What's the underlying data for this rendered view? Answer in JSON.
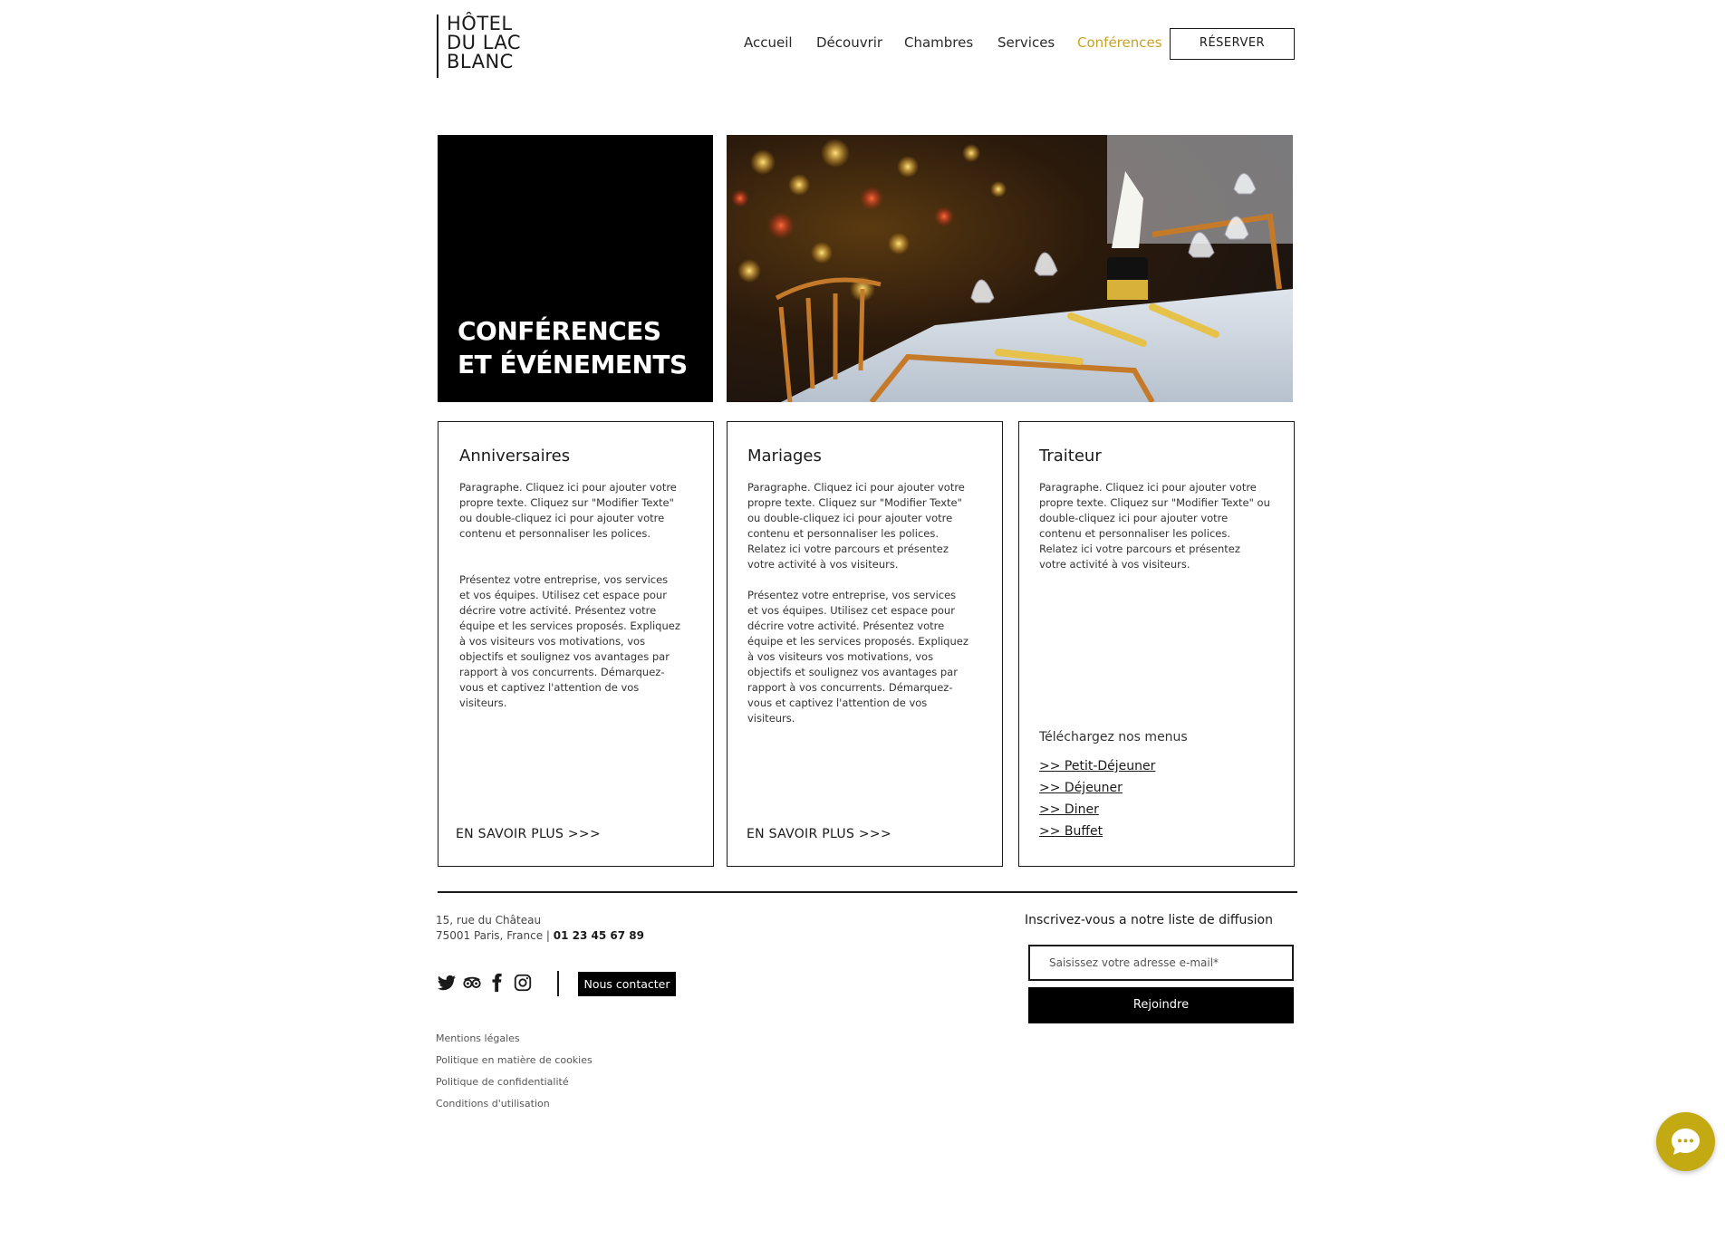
{
  "header": {
    "logo_lines": [
      "HÔTEL",
      "DU LAC",
      "BLANC"
    ],
    "nav": [
      "Accueil",
      "Découvrir",
      "Chambres",
      "Services",
      "Conférences"
    ],
    "active_nav": "Conférences",
    "reserve_label": "RÉSERVER"
  },
  "hero": {
    "title_line1": "CONFÉRENCES",
    "title_line2": "ET ÉVÉNEMENTS"
  },
  "cards": [
    {
      "title": "Anniversaires",
      "para1": "Paragraphe. Cliquez ici pour ajouter votre propre texte. Cliquez sur \"Modifier Texte\" ou double-cliquez ici pour ajouter votre contenu et personnaliser les polices.",
      "para2": "Présentez votre entreprise, vos services et vos équipes. Utilisez cet espace pour décrire votre activité. Présentez votre équipe et les services proposés. Expliquez à vos visiteurs vos motivations, vos objectifs et soulignez vos avantages par rapport à vos concurrents. Démarquez-vous et captivez l'attention de vos visiteurs.",
      "link": "EN SAVOIR PLUS >>>"
    },
    {
      "title": "Mariages",
      "para1": "Paragraphe. Cliquez ici pour ajouter votre propre texte. Cliquez sur \"Modifier Texte\" ou double-cliquez ici pour ajouter votre contenu et personnaliser les polices. Relatez ici votre parcours et présentez votre activité à vos visiteurs.",
      "para2": "Présentez votre entreprise, vos services et vos équipes. Utilisez cet espace pour décrire votre activité. Présentez votre équipe et les services proposés. Expliquez à vos visiteurs vos motivations, vos objectifs et soulignez vos avantages par rapport à vos concurrents. Démarquez-vous et captivez l'attention de vos visiteurs.",
      "link": "EN SAVOIR PLUS >>>"
    },
    {
      "title": "Traiteur",
      "para1": "Paragraphe. Cliquez ici pour ajouter votre propre texte. Cliquez sur \"Modifier Texte\" ou double-cliquez ici pour ajouter votre contenu et personnaliser les polices. Relatez ici votre parcours et présentez votre activité à vos visiteurs.",
      "menus_heading": "Téléchargez nos menus",
      "menus": [
        ">> Petit-Déjeuner",
        ">> Déjeuner",
        ">> Diner",
        ">> Buffet"
      ]
    }
  ],
  "footer": {
    "address_line1": "15, rue du Château",
    "address_line2": "75001 Paris, France | ",
    "phone": "01 23 45 67 89",
    "social_icons": [
      "twitter-icon",
      "tripadvisor-icon",
      "facebook-icon",
      "instagram-icon"
    ],
    "contact_label": "Nous contacter",
    "legal": [
      "Mentions légales",
      "Politique en matière de cookies",
      "Politique de confidentialité",
      "Conditions d'utilisation"
    ],
    "newsletter_title": "Inscrivez-vous a notre liste de diffusion",
    "email_placeholder": "Saisissez votre adresse e-mail*",
    "join_label": "Rejoindre"
  },
  "colors": {
    "accent": "#c9a227",
    "chat_button": "#c4aa12",
    "black": "#000000"
  }
}
